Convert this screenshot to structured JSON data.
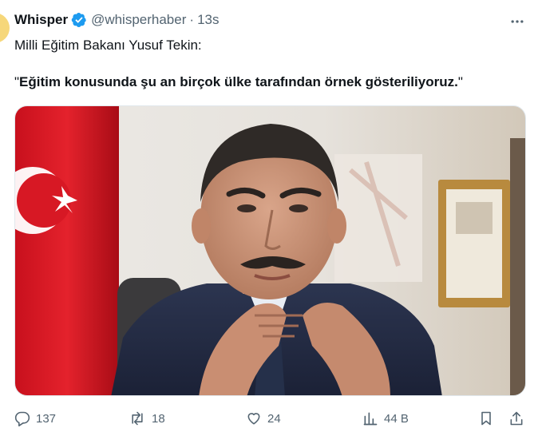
{
  "tweet": {
    "display_name": "Whisper",
    "handle": "@whisperhaber",
    "separator": "·",
    "time": "13s",
    "text_line1": "Milli Eğitim Bakanı Yusuf Tekin:",
    "quote_open": "\"",
    "quote_text": "Eğitim konusunda şu an birçok ülke tarafından örnek gösteriliyoruz.",
    "quote_close": "\""
  },
  "actions": {
    "replies": "137",
    "reposts": "18",
    "likes": "24",
    "views": "44 B"
  },
  "icons": {
    "verified": "verified-badge-icon",
    "more": "more-dots-icon",
    "reply": "reply-bubble-icon",
    "repost": "repost-icon",
    "like": "heart-icon",
    "views": "views-bar-chart-icon",
    "bookmark": "bookmark-icon",
    "share": "share-upload-icon"
  },
  "colors": {
    "text": "#0f1419",
    "muted": "#536471",
    "verified_blue": "#1d9bf0",
    "flag_red": "#e30a17"
  }
}
